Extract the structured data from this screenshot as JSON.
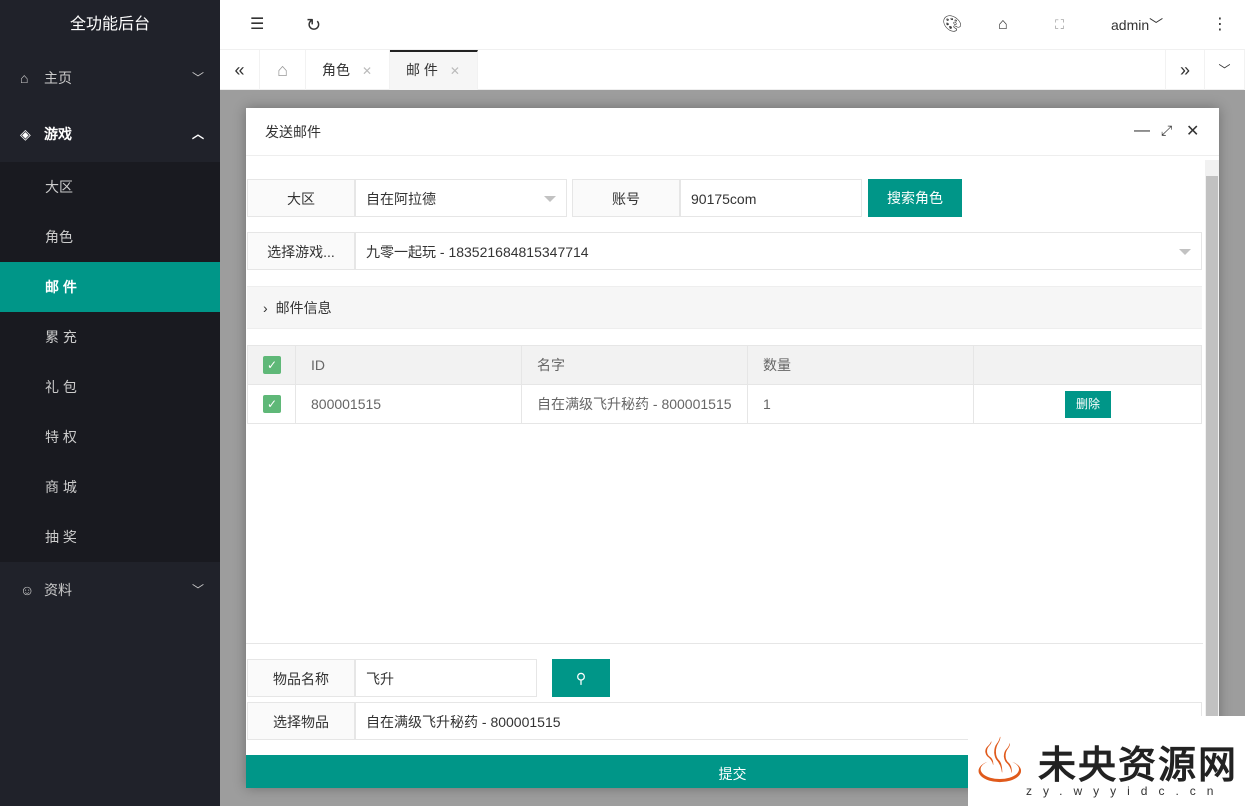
{
  "app": {
    "title": "全功能后台"
  },
  "sidebar": {
    "items": [
      {
        "label": "主页",
        "icon": "home-icon"
      },
      {
        "label": "游戏",
        "icon": "diamond-icon",
        "children": [
          "大区",
          "角色",
          "邮 件",
          "累 充",
          "礼 包",
          "特 权",
          "商 城",
          "抽 奖"
        ],
        "active": "邮 件"
      },
      {
        "label": "资料",
        "icon": "user-icon"
      }
    ]
  },
  "header": {
    "user": "admin"
  },
  "tabs": [
    {
      "label": "角色"
    },
    {
      "label": "邮 件",
      "active": true
    }
  ],
  "modal": {
    "title": "发送邮件",
    "region_label": "大区",
    "region_value": "自在阿拉德",
    "account_label": "账号",
    "account_value": "90175com",
    "search_role_button": "搜索角色",
    "role_label": "选择游戏...",
    "role_value": "九零一起玩 - 183521684815347714",
    "mail_info": "邮件信息",
    "table": {
      "headers": [
        "ID",
        "名字",
        "数量",
        ""
      ],
      "rows": [
        {
          "id": "800001515",
          "name": "自在满级飞升秘药 - 800001515",
          "qty": "1",
          "action": "删除",
          "checked": true
        }
      ]
    },
    "item_name_label": "物品名称",
    "item_name_value": "飞升",
    "select_item_label": "选择物品",
    "select_item_value": "自在满级飞升秘药 - 800001515",
    "submit": "提交"
  },
  "watermark": {
    "text": "未央资源网",
    "url": "zy.wyyidc.cn"
  },
  "colors": {
    "accent": "#009688",
    "sidebar": "#20222a"
  }
}
